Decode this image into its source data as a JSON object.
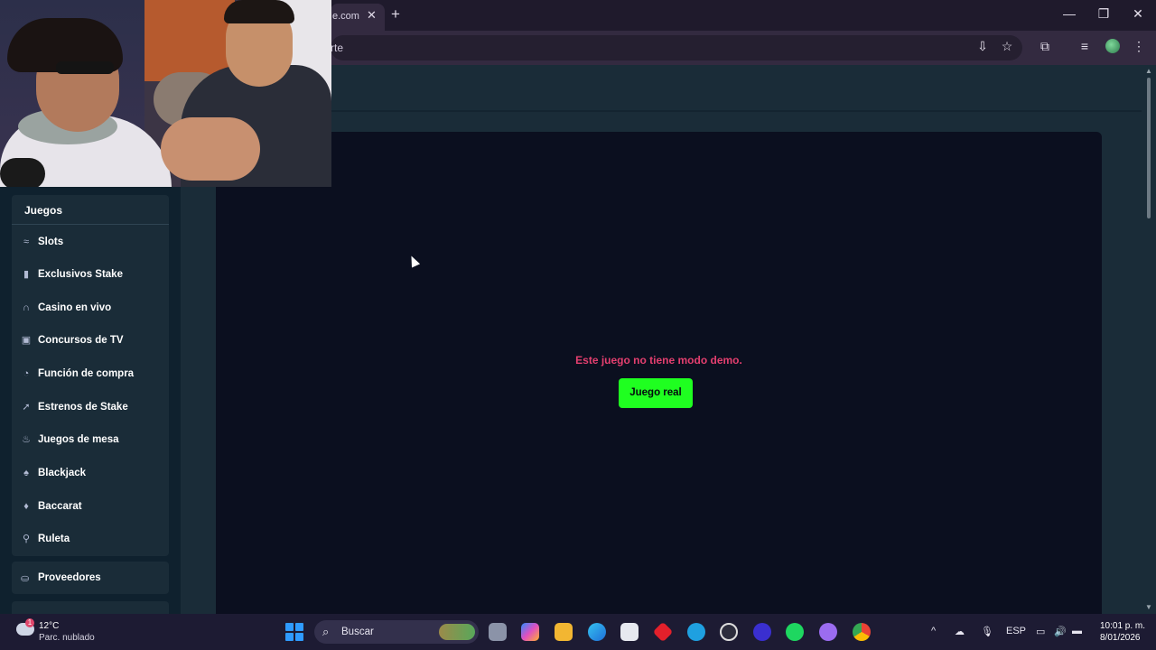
{
  "browser": {
    "tab_title": "e.com/",
    "tab_close": "✕",
    "new_tab": "+",
    "address_fragment": "rte",
    "window_minimize": "—",
    "window_restore": "❐",
    "window_close": "✕"
  },
  "sidebar": {
    "heading": "Juegos",
    "items": [
      {
        "label": "Slots",
        "icon": "slots-icon",
        "glyph": "≈"
      },
      {
        "label": "Exclusivos Stake",
        "icon": "bookmark-icon",
        "glyph": "▮"
      },
      {
        "label": "Casino en vivo",
        "icon": "headphones-icon",
        "glyph": "∩"
      },
      {
        "label": "Concursos de TV",
        "icon": "gift-icon",
        "glyph": "▣"
      },
      {
        "label": "Función de compra",
        "icon": "buy-feature-icon",
        "glyph": "◔"
      },
      {
        "label": "Estrenos de Stake",
        "icon": "rocket-icon",
        "glyph": "➚"
      },
      {
        "label": "Juegos de mesa",
        "icon": "flame-icon",
        "glyph": "♨"
      },
      {
        "label": "Blackjack",
        "icon": "blackjack-icon",
        "glyph": "♠"
      },
      {
        "label": "Baccarat",
        "icon": "cards-icon",
        "glyph": "♦"
      },
      {
        "label": "Ruleta",
        "icon": "roulette-icon",
        "glyph": "⚲"
      }
    ],
    "providers": "Proveedores"
  },
  "game": {
    "message": "Este juego no tiene modo demo.",
    "button": "Juego real"
  },
  "taskbar": {
    "weather_badge": "1",
    "temperature": "12°C",
    "weather_desc": "Parc. nublado",
    "search_label": "Buscar",
    "language": "ESP",
    "time": "10:01 p. m.",
    "date": "8/01/2026"
  },
  "colors": {
    "accent_green": "#1fff20",
    "error_pink": "#e43f6f",
    "sidebar_bg": "#0f212e",
    "panel_bg": "#1a2c38",
    "game_bg": "#0b0f1f"
  }
}
